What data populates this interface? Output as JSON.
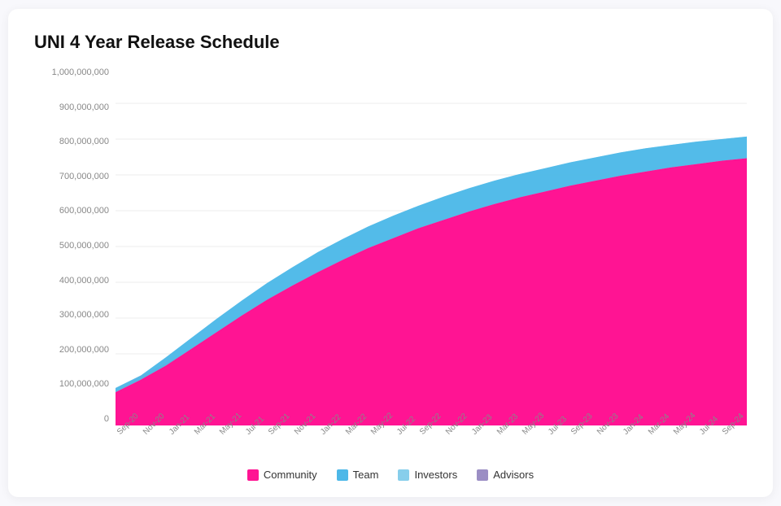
{
  "title": "UNI 4 Year Release Schedule",
  "yAxis": {
    "labels": [
      "1,000,000,000",
      "900,000,000",
      "800,000,000",
      "700,000,000",
      "600,000,000",
      "500,000,000",
      "400,000,000",
      "300,000,000",
      "200,000,000",
      "100,000,000",
      "0"
    ]
  },
  "xAxis": {
    "labels": [
      "Sep-20",
      "Nov-20",
      "Jan-21",
      "Mar-21",
      "May-21",
      "Jul-21",
      "Sep-21",
      "Nov-21",
      "Jan-22",
      "Mar-22",
      "May-22",
      "Jul-22",
      "Sep-22",
      "Nov-22",
      "Jan-23",
      "Mar-23",
      "May-23",
      "Jul-23",
      "Sep-23",
      "Nov-23",
      "Jan-24",
      "Mar-24",
      "May-24",
      "Jul-24",
      "Sep-24"
    ]
  },
  "legend": [
    {
      "label": "Community",
      "color": "#FF1493"
    },
    {
      "label": "Team",
      "color": "#4DB8E8"
    },
    {
      "label": "Investors",
      "color": "#87CEEB"
    },
    {
      "label": "Advisors",
      "color": "#9B8EC4"
    }
  ],
  "colors": {
    "community": "#FF1493",
    "team": "#4DB8E8",
    "investors": "#87CEEB",
    "advisors": "#9B8EC4",
    "gridLine": "#eee"
  }
}
